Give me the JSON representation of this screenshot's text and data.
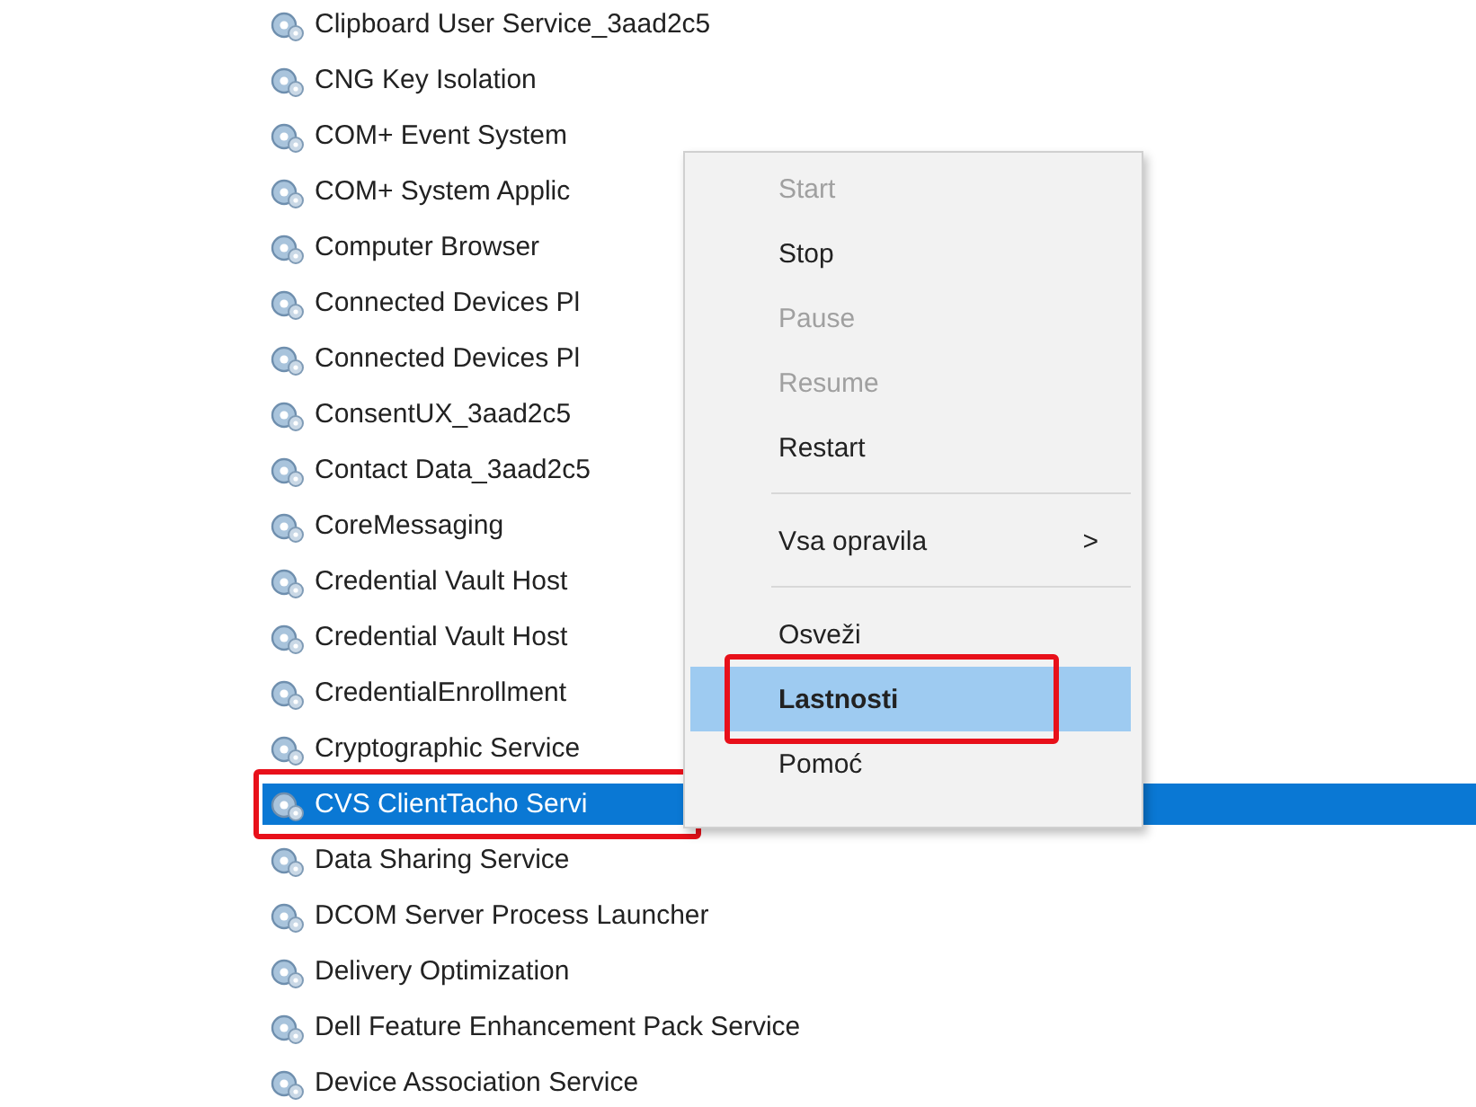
{
  "services": [
    {
      "name": "Clipboard User Service_3aad2c5",
      "selected": false,
      "framed": false
    },
    {
      "name": "CNG Key Isolation",
      "selected": false,
      "framed": false
    },
    {
      "name": "COM+ Event System",
      "selected": false,
      "framed": false
    },
    {
      "name": "COM+ System Applic",
      "selected": false,
      "framed": false
    },
    {
      "name": "Computer Browser",
      "selected": false,
      "framed": false
    },
    {
      "name": "Connected Devices Pl",
      "selected": false,
      "framed": false
    },
    {
      "name": "Connected Devices Pl",
      "selected": false,
      "framed": false
    },
    {
      "name": "ConsentUX_3aad2c5",
      "selected": false,
      "framed": false
    },
    {
      "name": "Contact Data_3aad2c5",
      "selected": false,
      "framed": false
    },
    {
      "name": "CoreMessaging",
      "selected": false,
      "framed": false
    },
    {
      "name": "Credential Vault Host",
      "selected": false,
      "framed": false
    },
    {
      "name": "Credential Vault Host",
      "selected": false,
      "framed": false
    },
    {
      "name": "CredentialEnrollment",
      "selected": false,
      "framed": false
    },
    {
      "name": "Cryptographic Service",
      "selected": false,
      "framed": false
    },
    {
      "name": "CVS ClientTacho Servi",
      "selected": true,
      "framed": true
    },
    {
      "name": "Data Sharing Service",
      "selected": false,
      "framed": false
    },
    {
      "name": "DCOM Server Process Launcher",
      "selected": false,
      "framed": false
    },
    {
      "name": "Delivery Optimization",
      "selected": false,
      "framed": false
    },
    {
      "name": "Dell Feature Enhancement Pack Service",
      "selected": false,
      "framed": false
    },
    {
      "name": "Device Association Service",
      "selected": false,
      "framed": false
    }
  ],
  "context_menu": [
    {
      "kind": "item",
      "label": "Start",
      "disabled": true,
      "selected": false,
      "default": false,
      "framed": false
    },
    {
      "kind": "item",
      "label": "Stop",
      "disabled": false,
      "selected": false,
      "default": false,
      "framed": false
    },
    {
      "kind": "item",
      "label": "Pause",
      "disabled": true,
      "selected": false,
      "default": false,
      "framed": false
    },
    {
      "kind": "item",
      "label": "Resume",
      "disabled": true,
      "selected": false,
      "default": false,
      "framed": false
    },
    {
      "kind": "item",
      "label": "Restart",
      "disabled": false,
      "selected": false,
      "default": false,
      "framed": false
    },
    {
      "kind": "separator"
    },
    {
      "kind": "item",
      "label": "Vsa opravila",
      "arrow": ">",
      "disabled": false,
      "selected": false,
      "default": false,
      "framed": false
    },
    {
      "kind": "separator"
    },
    {
      "kind": "item",
      "label": "Osveži",
      "disabled": false,
      "selected": false,
      "default": false,
      "framed": false
    },
    {
      "kind": "item",
      "label": "Lastnosti",
      "disabled": false,
      "selected": true,
      "default": true,
      "framed": true
    },
    {
      "kind": "item",
      "label": "Pomoć",
      "disabled": false,
      "selected": false,
      "default": false,
      "framed": false
    }
  ]
}
